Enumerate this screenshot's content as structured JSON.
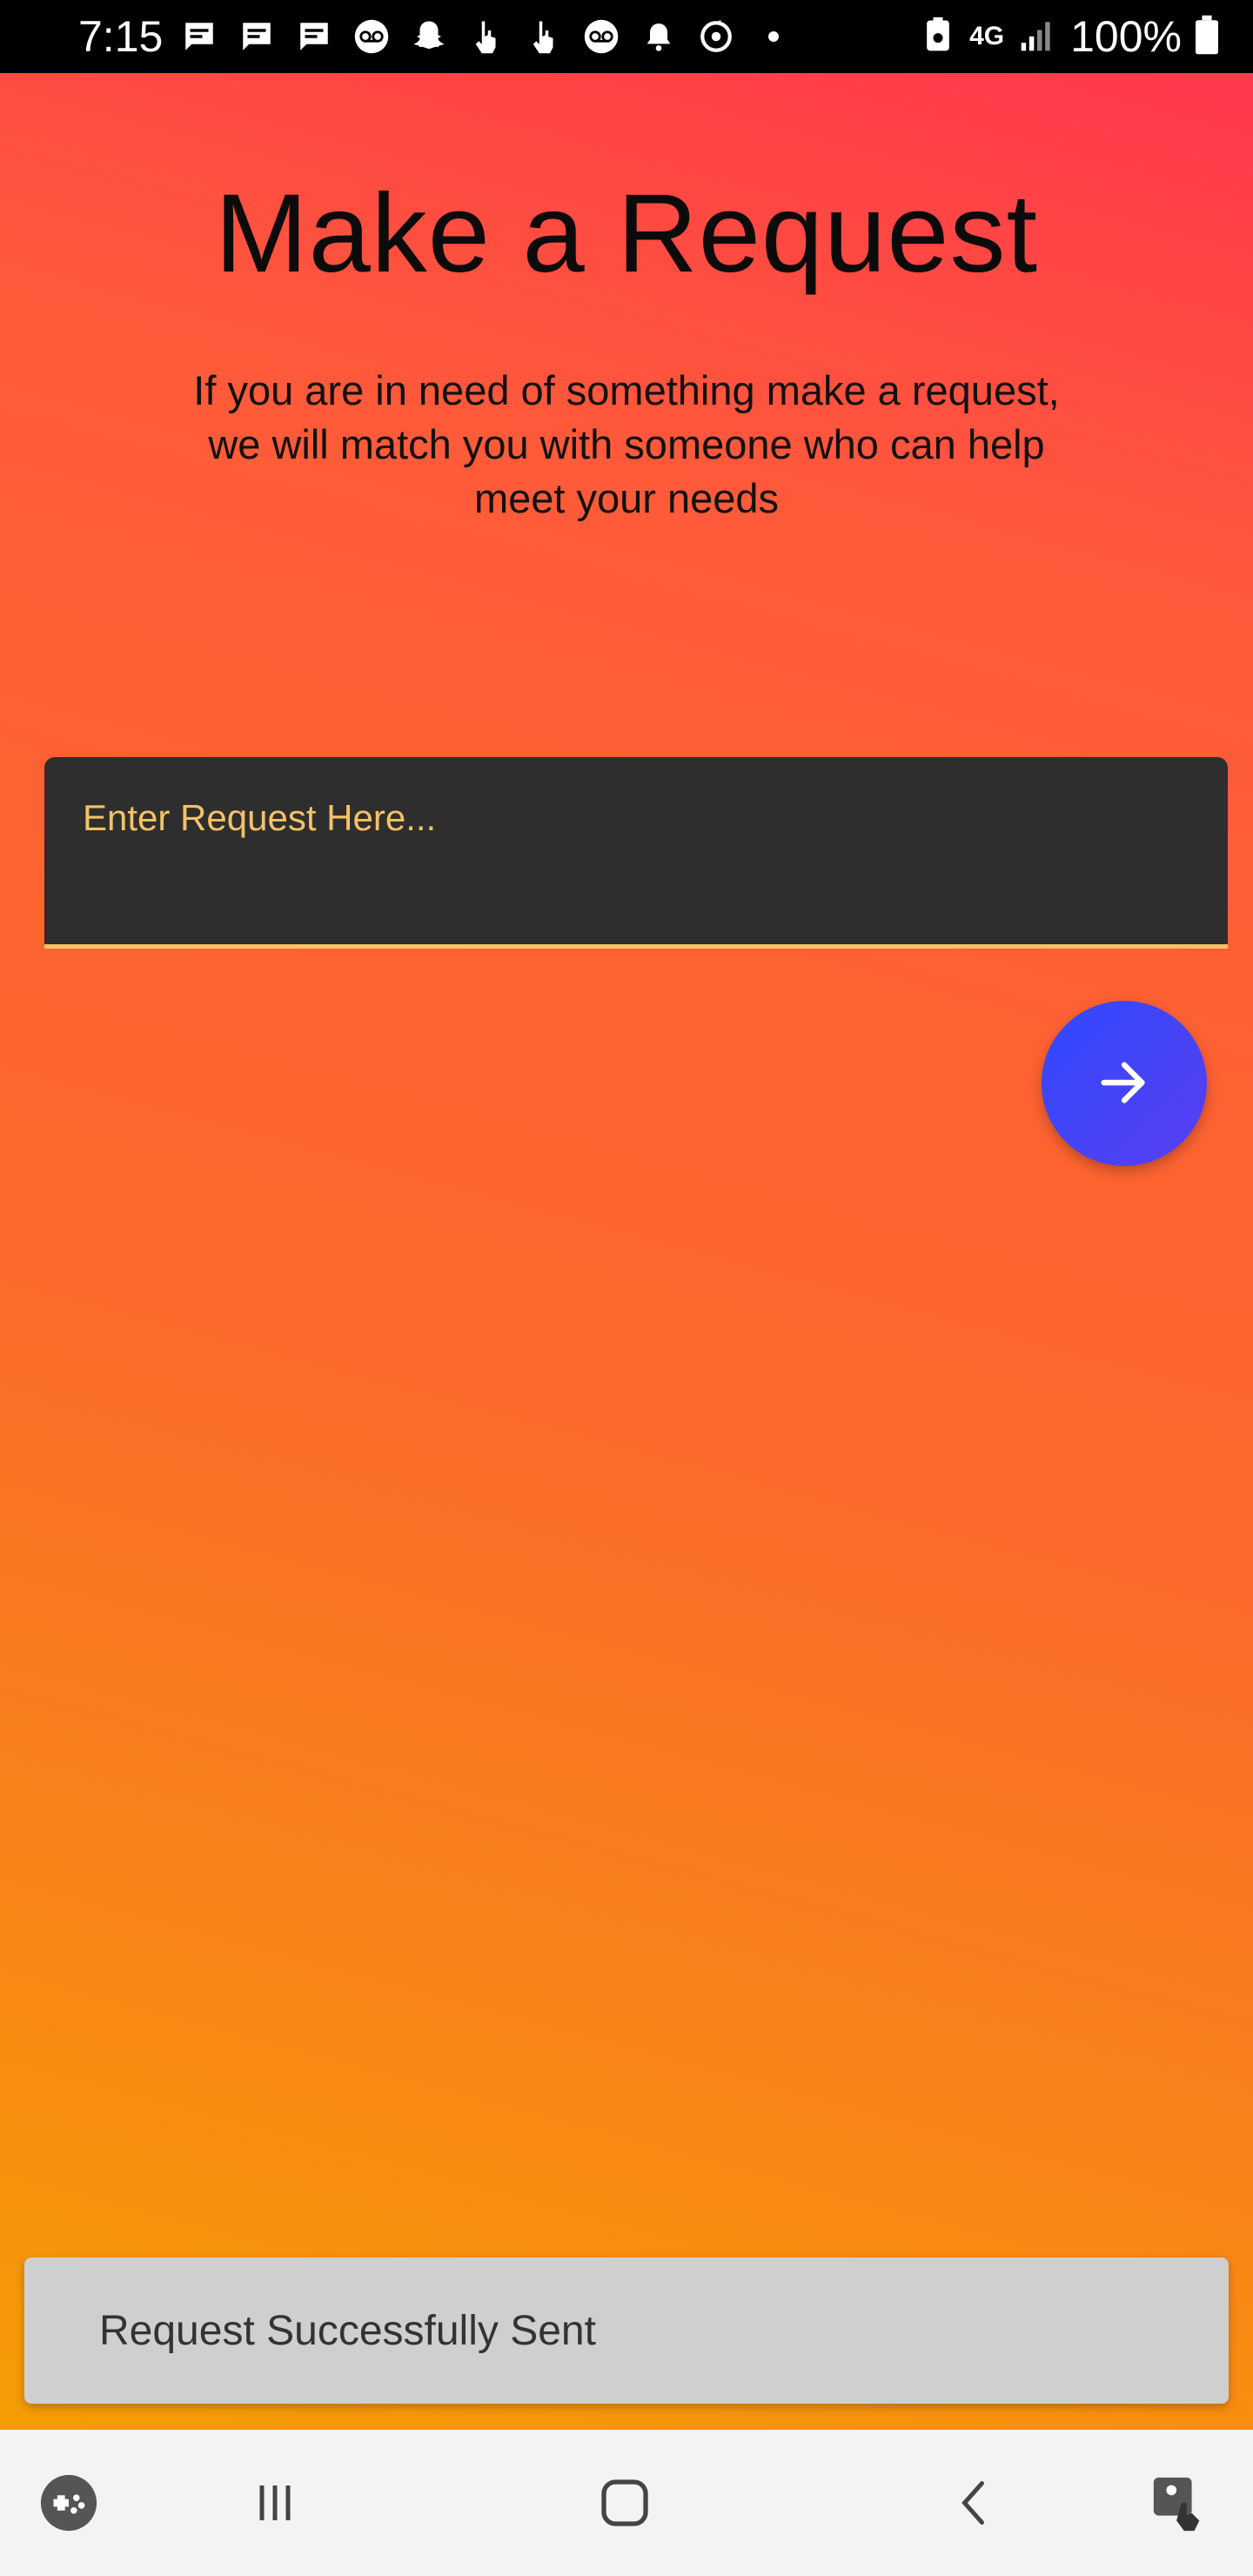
{
  "status_bar": {
    "time": "7:15",
    "network": "4G",
    "battery": "100%",
    "notification_icons": [
      "message-icon",
      "message-icon",
      "message-icon",
      "voicemail-icon",
      "snapchat-icon",
      "touch-icon",
      "touch-icon",
      "voicemail-icon",
      "bell-icon",
      "sync-icon",
      "dot-icon"
    ]
  },
  "page": {
    "title": "Make a Request",
    "subtitle": "If you are in need of something make a request, we will match you with someone who can help meet your needs"
  },
  "request_input": {
    "placeholder": "Enter Request Here...",
    "value": ""
  },
  "send_button": {
    "icon": "arrow-right-icon"
  },
  "snackbar": {
    "message": "Request Successfully Sent"
  },
  "nav_bar": {
    "buttons": [
      "game-launcher-icon",
      "recent-apps-icon",
      "home-icon",
      "back-icon",
      "accessibility-icon"
    ]
  },
  "colors": {
    "gradient_top": "#ff334f",
    "gradient_bottom": "#f5a300",
    "input_background": "#2e2e2e",
    "input_accent": "#f6c167",
    "fab_blue": "#2f49ff",
    "snackbar_background": "#cfcfcf"
  }
}
